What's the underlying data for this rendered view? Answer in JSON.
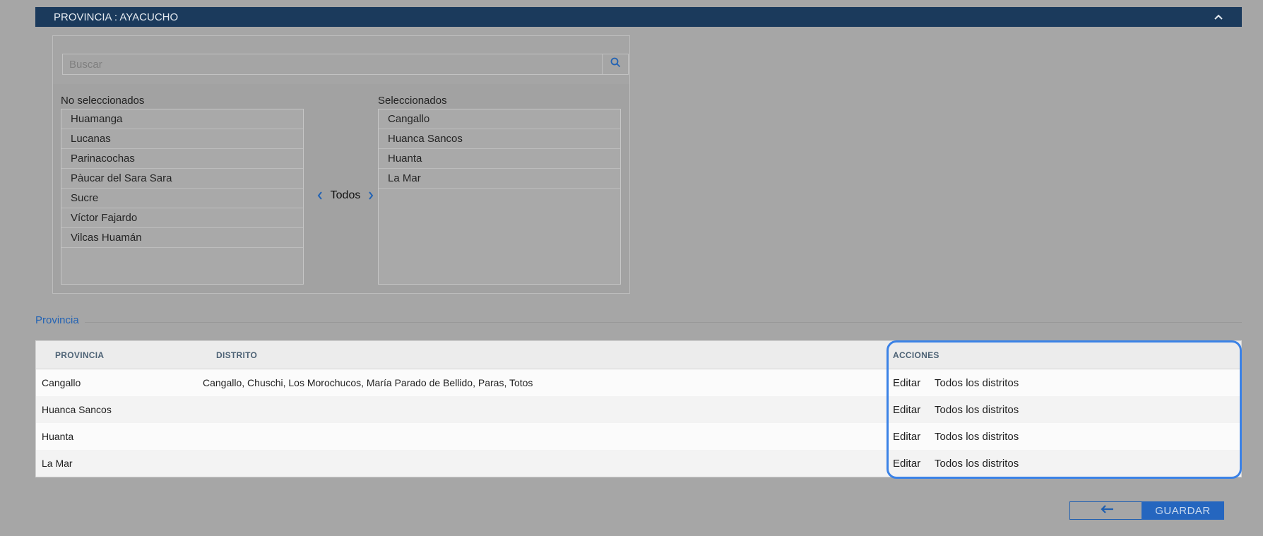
{
  "header": {
    "title": "PROVINCIA : AYACUCHO",
    "collapse_icon": "chevron-up-icon"
  },
  "search": {
    "placeholder": "Buscar",
    "value": "",
    "icon": "search-icon"
  },
  "unselected": {
    "label": "No seleccionados",
    "items": [
      "Huamanga",
      "Lucanas",
      "Parinacochas",
      "Pàucar del Sara Sara",
      "Sucre",
      "Víctor Fajardo",
      "Vilcas Huamán"
    ]
  },
  "mover": {
    "label": "Todos",
    "left_icon": "chevron-left-icon",
    "right_icon": "chevron-right-icon"
  },
  "selected": {
    "label": "Seleccionados",
    "items": [
      "Cangallo",
      "Huanca Sancos",
      "Huanta",
      "La Mar"
    ]
  },
  "section": {
    "label": "Provincia"
  },
  "table": {
    "headers": {
      "provincia": "PROVINCIA",
      "distrito": "DISTRITO",
      "acciones": "ACCIONES"
    },
    "rows": [
      {
        "provincia": "Cangallo",
        "distrito": "Cangallo, Chuschi, Los Morochucos, María Parado de Bellido, Paras, Totos",
        "edit": "Editar",
        "all": "Todos los distritos"
      },
      {
        "provincia": "Huanca Sancos",
        "distrito": "",
        "edit": "Editar",
        "all": "Todos los distritos"
      },
      {
        "provincia": "Huanta",
        "distrito": "",
        "edit": "Editar",
        "all": "Todos los distritos"
      },
      {
        "provincia": "La Mar",
        "distrito": "",
        "edit": "Editar",
        "all": "Todos los distritos"
      }
    ]
  },
  "footer": {
    "back_icon": "arrow-left-icon",
    "save_label": "GUARDAR"
  },
  "colors": {
    "header_bg": "#1b3a5c",
    "accent": "#2566bf",
    "highlight": "#3b82e6"
  }
}
